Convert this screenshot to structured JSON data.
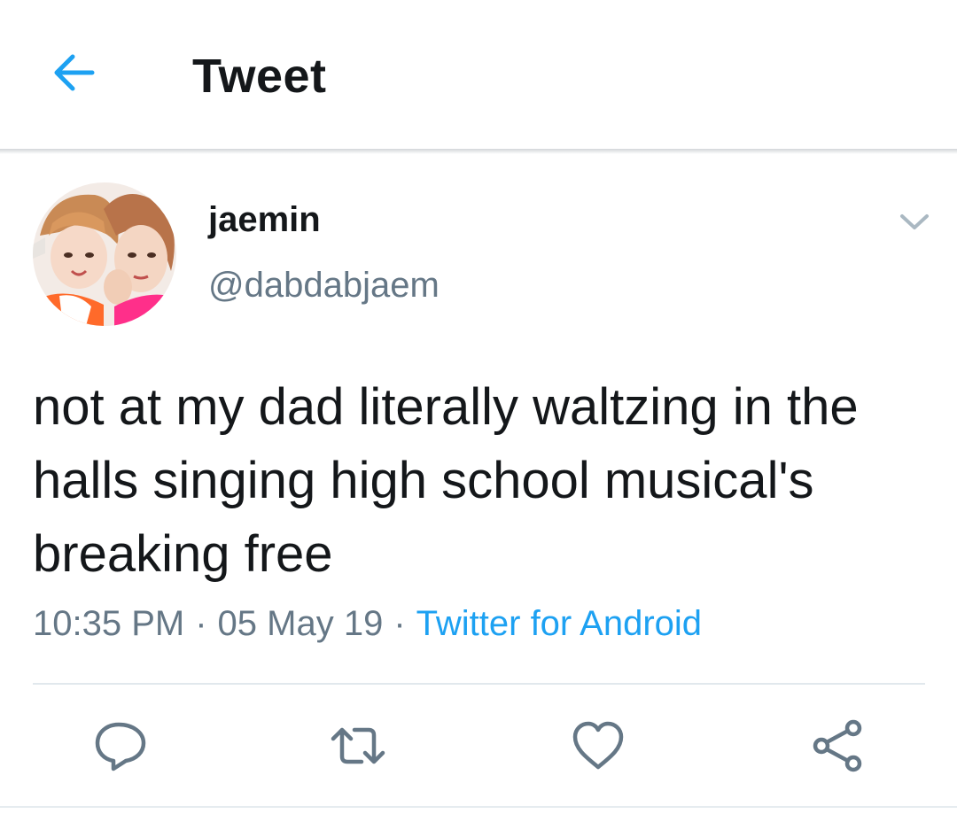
{
  "header": {
    "title": "Tweet",
    "back_icon": "arrow-left-icon",
    "accent_color": "#1da1f2"
  },
  "tweet": {
    "author": {
      "display_name": "jaemin",
      "handle": "@dabdabjaem",
      "avatar": "avatar-photo"
    },
    "text": "not at my dad literally waltzing in the halls singing high school musical's breaking free",
    "time": "10:35 PM",
    "separator": "·",
    "date": "05 May 19",
    "source": "Twitter for Android",
    "menu_icon": "chevron-down-icon"
  },
  "actions": [
    {
      "name": "reply",
      "icon": "reply-icon"
    },
    {
      "name": "retweet",
      "icon": "retweet-icon"
    },
    {
      "name": "like",
      "icon": "heart-icon"
    },
    {
      "name": "share",
      "icon": "share-icon"
    }
  ],
  "colors": {
    "text": "#14171a",
    "secondary": "#657786",
    "link": "#1da1f2",
    "divider": "#e1e8ed"
  }
}
